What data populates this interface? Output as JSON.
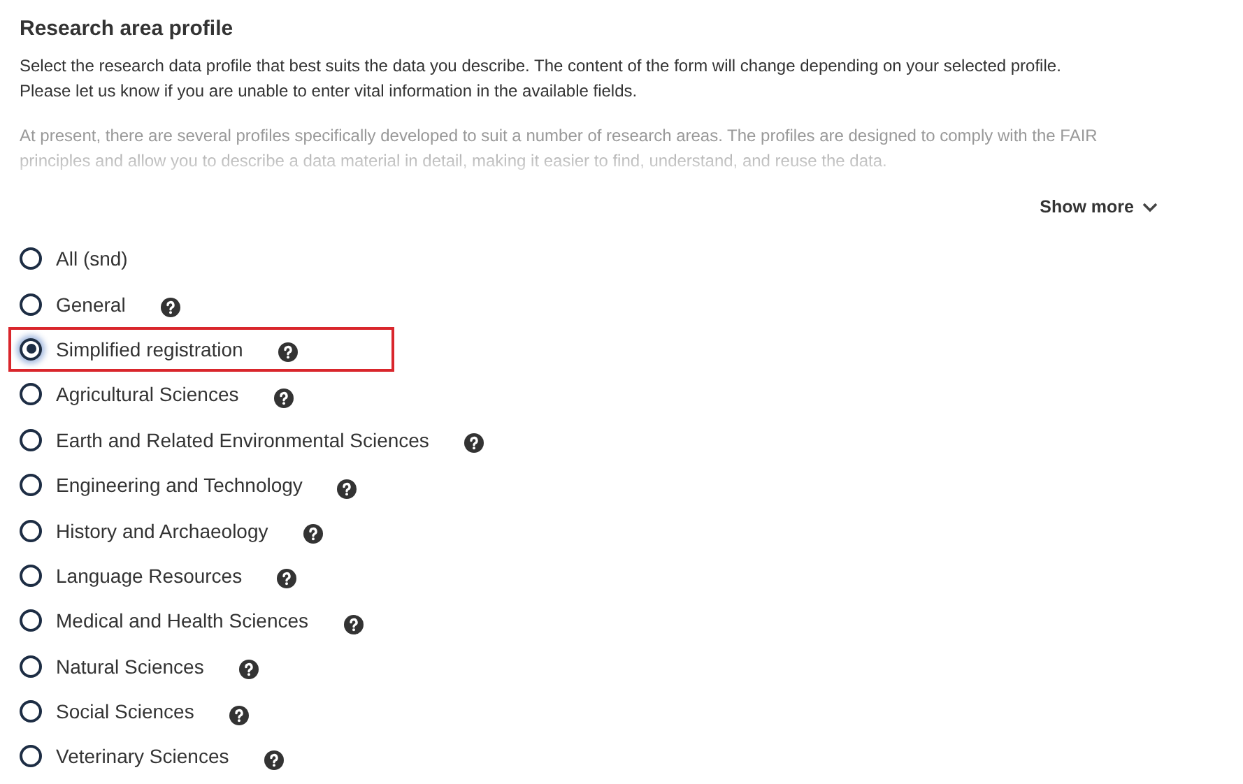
{
  "title": "Research area profile",
  "intro": [
    "Select the research data profile that best suits the data you describe. The content of the form will change depending on your selected profile.",
    "Please let us know if you are unable to enter vital information in the available fields."
  ],
  "more": {
    "text": "At present, there are several profiles specifically developed to suit a number of research areas. The profiles are designed to comply with the FAIR principles and allow you to describe a data material in detail, making it easier to find, understand, and reuse the data.",
    "expanded": false
  },
  "show_more": "Show more",
  "profiles": [
    {
      "label": "All (snd)",
      "selected": false,
      "help": false,
      "highlighted": false
    },
    {
      "label": "General",
      "selected": false,
      "help": true,
      "highlighted": false
    },
    {
      "label": "Simplified registration",
      "selected": true,
      "help": true,
      "highlighted": true
    },
    {
      "label": "Agricultural Sciences",
      "selected": false,
      "help": true,
      "highlighted": false
    },
    {
      "label": "Earth and Related Environmental Sciences",
      "selected": false,
      "help": true,
      "highlighted": false
    },
    {
      "label": "Engineering and Technology",
      "selected": false,
      "help": true,
      "highlighted": false
    },
    {
      "label": "History and Archaeology",
      "selected": false,
      "help": true,
      "highlighted": false
    },
    {
      "label": "Language Resources",
      "selected": false,
      "help": true,
      "highlighted": false
    },
    {
      "label": "Medical and Health Sciences",
      "selected": false,
      "help": true,
      "highlighted": false
    },
    {
      "label": "Natural Sciences",
      "selected": false,
      "help": true,
      "highlighted": false
    },
    {
      "label": "Social Sciences",
      "selected": false,
      "help": true,
      "highlighted": false
    },
    {
      "label": "Veterinary Sciences",
      "selected": false,
      "help": true,
      "highlighted": false
    }
  ]
}
